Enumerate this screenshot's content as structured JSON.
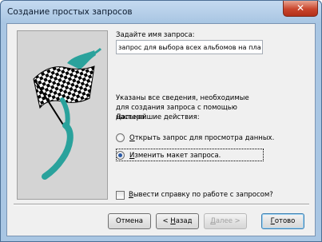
{
  "window": {
    "title": "Создание простых запросов"
  },
  "form": {
    "name_prompt": "Задайте имя запроса:",
    "name_value": "запрос для выбора всех альбомов на плас",
    "info_text": "Указаны все сведения, необходимые для создания запроса с помощью настера.",
    "next_actions_label": "Дальнейшие действия:",
    "options": [
      {
        "label_first": "О",
        "label_rest": "ткрыть запрос для просмотра данных.",
        "selected": false
      },
      {
        "label_first": "И",
        "label_rest": "зменить макет запроса.",
        "selected": true
      }
    ],
    "help_checkbox_label_first": "В",
    "help_checkbox_label_rest": "ывести справку по работе с запросом?"
  },
  "buttons": {
    "cancel": "Отмена",
    "back_arrow": "< ",
    "back_first": "Н",
    "back_rest": "азад",
    "next_first": "Д",
    "next_rest": "алее >",
    "finish_first": "Г",
    "finish_rest": "отово"
  },
  "colors": {
    "title_bar": "#a9c6e3",
    "close_button": "#c9452c",
    "flag_pole": "#2aa29c",
    "dialog_bg": "#f0f0f0"
  }
}
